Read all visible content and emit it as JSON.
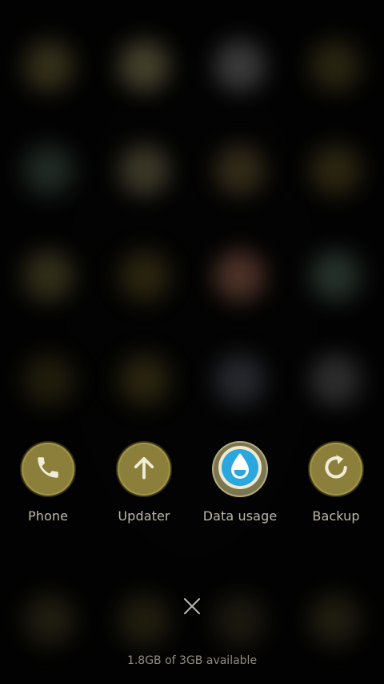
{
  "shortcuts": [
    {
      "label": "Phone",
      "icon": "phone-icon"
    },
    {
      "label": "Updater",
      "icon": "arrow-up-icon"
    },
    {
      "label": "Data usage",
      "icon": "water-drop-icon"
    },
    {
      "label": "Backup",
      "icon": "refresh-icon"
    }
  ],
  "close_icon": "close-icon",
  "memory_status": "1.8GB of 3GB available",
  "colors": {
    "background": "#030303",
    "gold_disc": "#8c7f3b",
    "icon_cream": "#f1ecd6",
    "data_blue": "#2aa7de",
    "label_text": "#bdb9ab",
    "memory_text": "#8f8b80"
  }
}
